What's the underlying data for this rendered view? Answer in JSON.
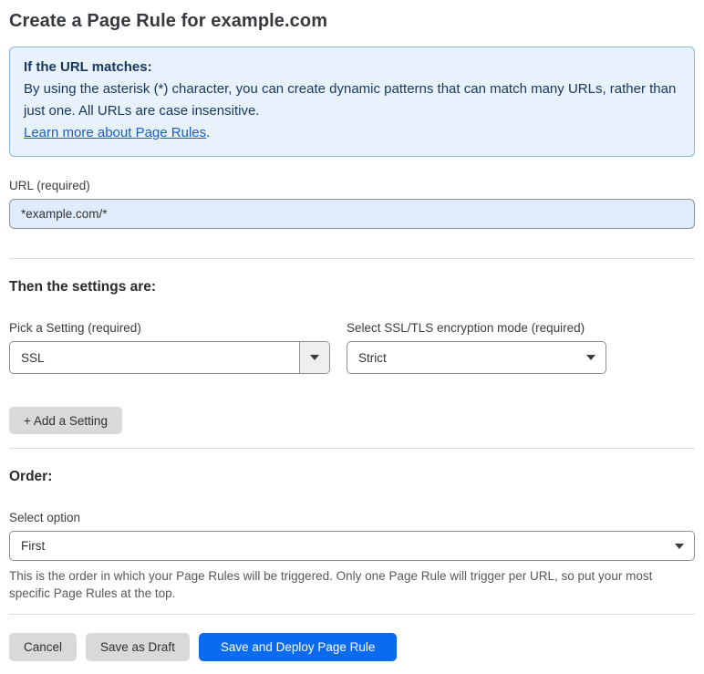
{
  "page": {
    "title": "Create a Page Rule for example.com"
  },
  "info_box": {
    "heading": "If the URL matches:",
    "body": "By using the asterisk (*) character, you can create dynamic patterns that can match many URLs, rather than just one. All URLs are case insensitive.",
    "link_label": "Learn more about Page Rules",
    "link_suffix": "."
  },
  "url_field": {
    "label": "URL (required)",
    "value": "*example.com/*"
  },
  "settings_section": {
    "heading": "Then the settings are:",
    "setting_select": {
      "label": "Pick a Setting (required)",
      "value": "SSL"
    },
    "mode_select": {
      "label": "Select SSL/TLS encryption mode (required)",
      "value": "Strict"
    },
    "add_setting_label": "+ Add a Setting"
  },
  "order_section": {
    "heading": "Order:",
    "select_label": "Select option",
    "value": "First",
    "help_text": "This is the order in which your Page Rules will be triggered. Only one Page Rule will trigger per URL, so put your most specific Page Rules at the top."
  },
  "footer": {
    "cancel_label": "Cancel",
    "save_draft_label": "Save as Draft",
    "save_deploy_label": "Save and Deploy Page Rule"
  },
  "colors": {
    "primary_button": "#0b6bef",
    "info_box_background": "#e8f2fc",
    "info_box_border": "#8ab7e4",
    "info_box_text": "#16365f",
    "link": "#1a5dc8",
    "url_input_background": "#dfecfb",
    "gray_button": "#d9d9d9"
  }
}
